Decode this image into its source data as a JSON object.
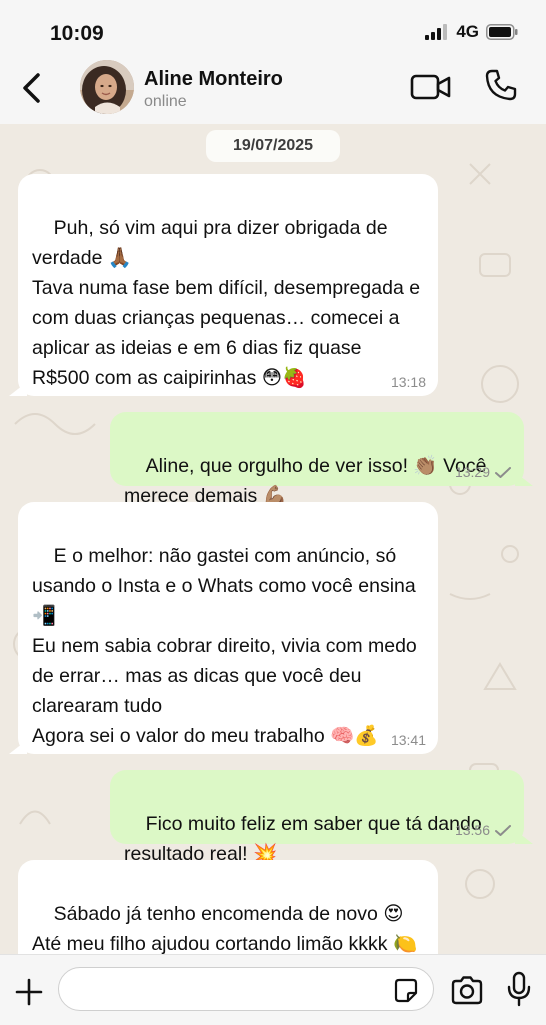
{
  "status": {
    "time": "10:09",
    "network": "4G"
  },
  "header": {
    "contact_name": "Aline Monteiro",
    "contact_status": "online"
  },
  "chat": {
    "date": "19/07/2025",
    "messages": [
      {
        "direction": "in",
        "text": "Puh, só vim aqui pra dizer obrigada de verdade 🙏🏾\nTava numa fase bem difícil, desempregada e com duas crianças pequenas… comecei a aplicar as ideias e em 6 dias fiz quase R$500 com as caipirinhas 😳🍓",
        "time": "13:18"
      },
      {
        "direction": "out",
        "text": "Aline, que orgulho de ver isso! 👏🏽 Você merece demais 💪🏽",
        "time": "13:29",
        "read_status": "sent"
      },
      {
        "direction": "in",
        "text": "E o melhor: não gastei com anúncio, só usando o Insta e o Whats como você ensina 📲\nEu nem sabia cobrar direito, vivia com medo de errar… mas as dicas que você deu clarearam tudo\nAgora sei o valor do meu trabalho 🧠💰",
        "time": "13:41"
      },
      {
        "direction": "out",
        "text": "Fico muito feliz em saber que tá dando resultado real! 💥",
        "time": "13:56",
        "read_status": "sent"
      },
      {
        "direction": "in",
        "text": "Sábado já tenho encomenda de novo 😍\nAté meu filho ajudou cortando limão kkkk 🍋",
        "time": ""
      }
    ]
  },
  "composer": {
    "placeholder": ""
  },
  "icons": {
    "back": "chevron-left-icon",
    "video": "video-camera-icon",
    "call": "phone-icon",
    "plus": "plus-icon",
    "sticker": "sticker-icon",
    "camera": "camera-icon",
    "mic": "microphone-icon"
  },
  "colors": {
    "incoming_bubble": "#ffffff",
    "outgoing_bubble": "#dcf8c6",
    "chat_background": "#efeae2"
  }
}
